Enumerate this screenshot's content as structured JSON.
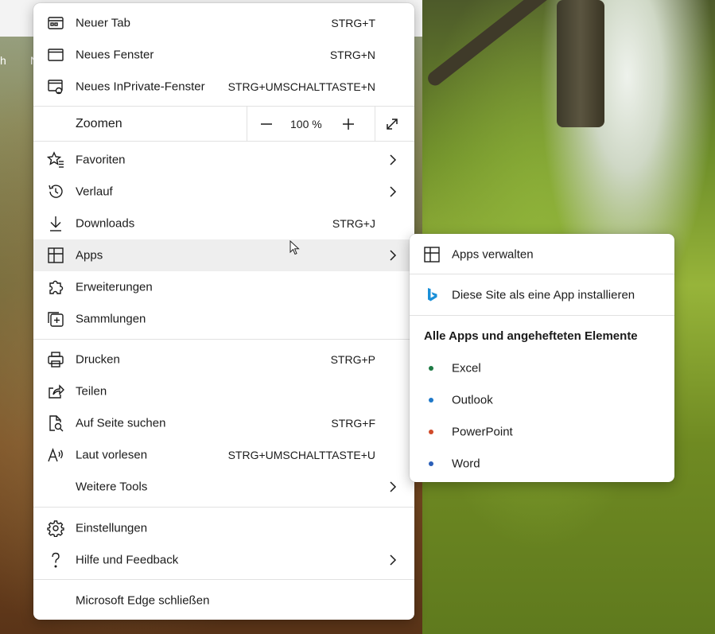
{
  "browser_bg": {
    "tab_fragment_1": "h",
    "tab_fragment_2": "N"
  },
  "menu": {
    "items": [
      {
        "label": "Neuer Tab",
        "shortcut": "STRG+T",
        "icon": "new-tab-icon"
      },
      {
        "label": "Neues Fenster",
        "shortcut": "STRG+N",
        "icon": "new-window-icon"
      },
      {
        "label": "Neues InPrivate-Fenster",
        "shortcut": "STRG+UMSCHALTTASTE+N",
        "icon": "inprivate-window-icon"
      },
      {
        "label": "Favoriten",
        "shortcut": "",
        "icon": "favorites-icon"
      },
      {
        "label": "Verlauf",
        "shortcut": "",
        "icon": "history-icon"
      },
      {
        "label": "Downloads",
        "shortcut": "STRG+J",
        "icon": "download-icon"
      },
      {
        "label": "Apps",
        "shortcut": "",
        "icon": "apps-icon"
      },
      {
        "label": "Erweiterungen",
        "shortcut": "",
        "icon": "extensions-icon"
      },
      {
        "label": "Sammlungen",
        "shortcut": "",
        "icon": "collections-icon"
      },
      {
        "label": "Drucken",
        "shortcut": "STRG+P",
        "icon": "print-icon"
      },
      {
        "label": "Teilen",
        "shortcut": "",
        "icon": "share-icon"
      },
      {
        "label": "Auf Seite suchen",
        "shortcut": "STRG+F",
        "icon": "find-on-page-icon"
      },
      {
        "label": "Laut vorlesen",
        "shortcut": "STRG+UMSCHALTTASTE+U",
        "icon": "read-aloud-icon"
      },
      {
        "label": "Weitere Tools",
        "shortcut": "",
        "icon": ""
      },
      {
        "label": "Einstellungen",
        "shortcut": "",
        "icon": "settings-icon"
      },
      {
        "label": "Hilfe und Feedback",
        "shortcut": "",
        "icon": "help-icon"
      },
      {
        "label": "Microsoft Edge schließen",
        "shortcut": "",
        "icon": ""
      }
    ],
    "zoom": {
      "label": "Zoomen",
      "value": "100 %",
      "minus": "−",
      "plus": "+"
    }
  },
  "submenu": {
    "manage_apps": "Apps verwalten",
    "install_site": "Diese Site als eine App installieren",
    "heading": "Alle Apps und angehefteten Elemente",
    "apps": [
      {
        "label": "Excel",
        "color": "#1d7a44"
      },
      {
        "label": "Outlook",
        "color": "#1f79c9"
      },
      {
        "label": "PowerPoint",
        "color": "#d04a2a"
      },
      {
        "label": "Word",
        "color": "#2b5fb8"
      }
    ]
  },
  "colors": {
    "hover": "#eeeeee",
    "separator": "#e1e1e1",
    "bing_blue": "#1a8fd8"
  }
}
